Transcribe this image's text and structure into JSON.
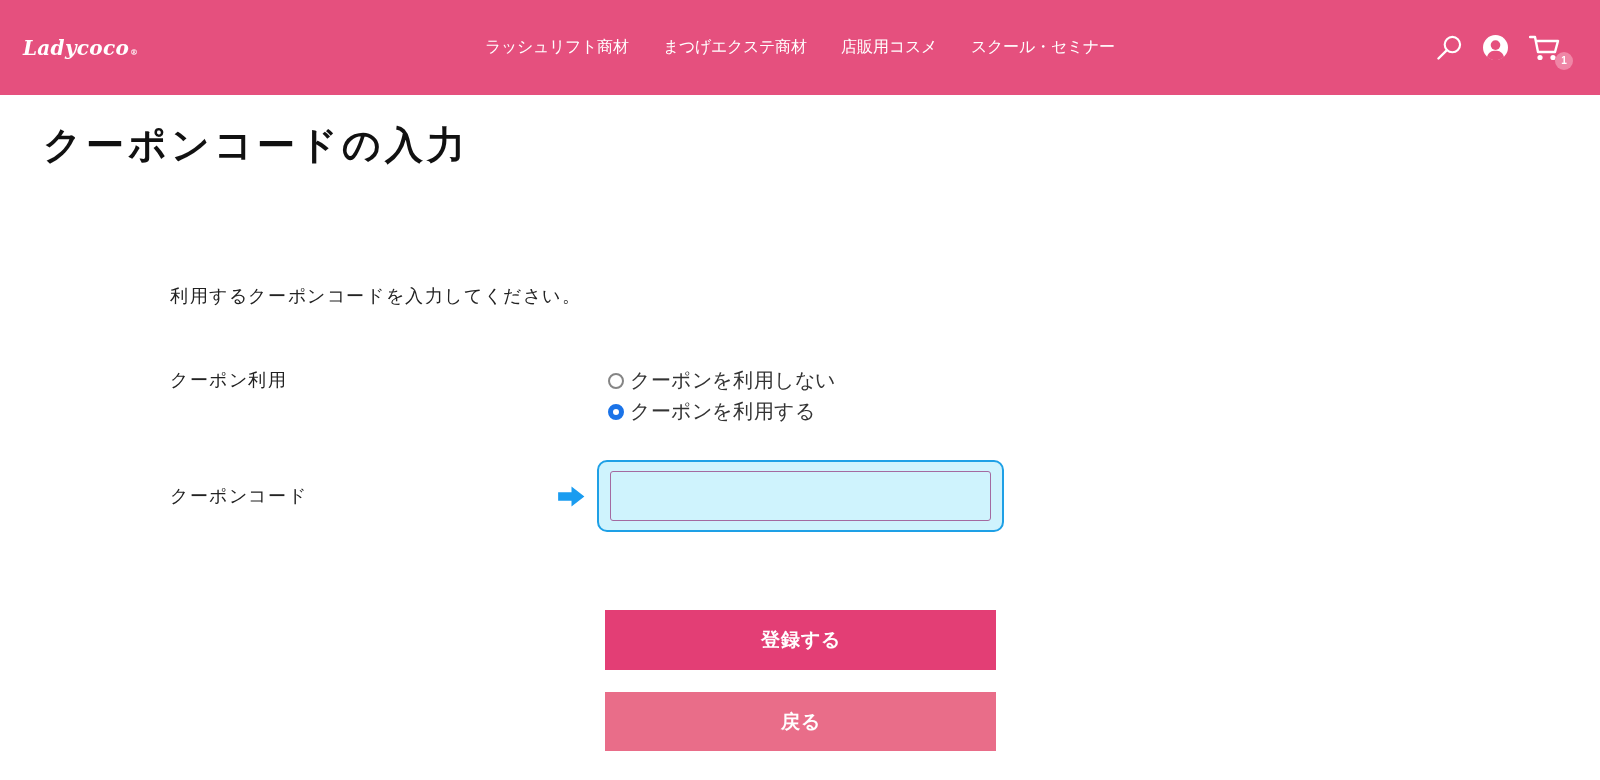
{
  "header": {
    "logo": "Ladycoco",
    "logo_mark": "®",
    "nav": [
      "ラッシュリフト商材",
      "まつげエクステ商材",
      "店販用コスメ",
      "スクール・セミナー"
    ],
    "cart_count": "1"
  },
  "page": {
    "title": "クーポンコードの入力"
  },
  "form": {
    "intro": "利用するクーポンコードを入力してください。",
    "coupon_use": {
      "label": "クーポン利用",
      "options": [
        {
          "label": "クーポンを利用しない",
          "selected": false
        },
        {
          "label": "クーポンを利用する",
          "selected": true
        }
      ]
    },
    "coupon_code": {
      "label": "クーポンコード",
      "focused": true
    }
  },
  "buttons": [
    {
      "label": "登録する",
      "kind": "primary"
    },
    {
      "label": "戻る",
      "kind": "secondary"
    }
  ]
}
